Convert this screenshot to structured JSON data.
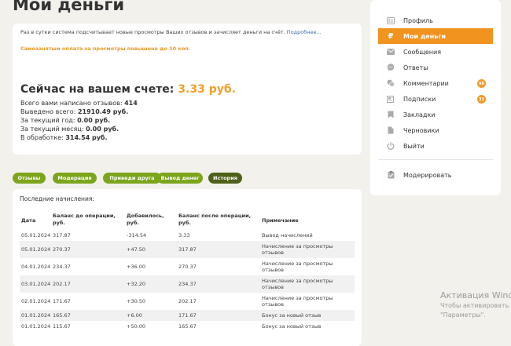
{
  "page": {
    "title": "Мои деньги"
  },
  "info": {
    "note": "Раз в сутки система подсчитывает новые просмотры Ваших отзывов и зачисляет деньги на счёт.",
    "more_link": "Подробнее...",
    "promo": "Самозанятым оплата за просмотры повышена до 10 коп.",
    "balance_label": "Сейчас на вашем счете:",
    "balance_value": "3.33 руб.",
    "stats": [
      {
        "label": "Всего вами написано отзывов:",
        "value": "414"
      },
      {
        "label": "Выведено всего:",
        "value": "21910.49 руб."
      },
      {
        "label": "За текущий год:",
        "value": "0.00 руб."
      },
      {
        "label": "За текущий месяц:",
        "value": "0.00 руб."
      },
      {
        "label": "В обработке:",
        "value": "314.54 руб."
      }
    ]
  },
  "tabs": [
    {
      "label": "Отзывы",
      "active": false
    },
    {
      "label": "Модерация",
      "active": false
    },
    {
      "label": "Приведи друга",
      "active": false
    },
    {
      "label": "Вывод денег",
      "active": false
    },
    {
      "label": "История",
      "active": true
    }
  ],
  "history": {
    "title": "Последние начисления:",
    "columns": [
      "Дата",
      "Баланс до операции, руб.",
      "Добавилось, руб.",
      "Баланс после операции, руб.",
      "Примечание"
    ],
    "rows": [
      {
        "date": "05.01.2024",
        "before": "317.87",
        "added": "-314.54",
        "after": "3.33",
        "note": "Вывод начислений"
      },
      {
        "date": "05.01.2024",
        "before": "270.37",
        "added": "+47.50",
        "after": "317.87",
        "note": "Начисление за просмотры отзывов"
      },
      {
        "date": "04.01.2024",
        "before": "234.37",
        "added": "+36.00",
        "after": "270.37",
        "note": "Начисление за просмотры отзывов"
      },
      {
        "date": "03.01.2024",
        "before": "202.17",
        "added": "+32.20",
        "after": "234.37",
        "note": "Начисление за просмотры отзывов"
      },
      {
        "date": "02.01.2024",
        "before": "171.67",
        "added": "+30.50",
        "after": "202.17",
        "note": "Начисление за просмотры отзывов"
      },
      {
        "date": "01.01.2024",
        "before": "165.67",
        "added": "+6.00",
        "after": "171.67",
        "note": "Бонус за новый отзыв"
      },
      {
        "date": "01.01.2024",
        "before": "115.67",
        "added": "+50.00",
        "after": "165.67",
        "note": "Бонус за новый отзыв"
      }
    ]
  },
  "sidebar": {
    "items": [
      {
        "label": "Профиль",
        "icon": "profile-card-icon",
        "active": false,
        "badge": ""
      },
      {
        "label": "Мои деньги",
        "icon": "ruble-icon",
        "active": true,
        "badge": ""
      },
      {
        "label": "Сообщения",
        "icon": "envelope-icon",
        "active": false,
        "badge": ""
      },
      {
        "label": "Ответы",
        "icon": "speech-bubble-icon",
        "active": false,
        "badge": ""
      },
      {
        "label": "Комментарии",
        "icon": "comments-icon",
        "active": false,
        "badge": "98"
      },
      {
        "label": "Подписки",
        "icon": "news-icon",
        "active": false,
        "badge": "31"
      },
      {
        "label": "Закладки",
        "icon": "bookmark-icon",
        "active": false,
        "badge": ""
      },
      {
        "label": "Черновики",
        "icon": "draft-icon",
        "active": false,
        "badge": ""
      },
      {
        "label": "Выйти",
        "icon": "power-icon",
        "active": false,
        "badge": ""
      }
    ],
    "moderate": {
      "label": "Модерировать",
      "icon": "check-clipboard-icon"
    }
  },
  "watermark": {
    "title": "Активация Windows",
    "line1": "Чтобы активировать Windows,",
    "line2": "\"Параметры\"."
  },
  "colors": {
    "accent": "#f0931f",
    "tab_green": "#7ca51c",
    "tab_active": "#4e6118",
    "link": "#3f6fa8"
  }
}
